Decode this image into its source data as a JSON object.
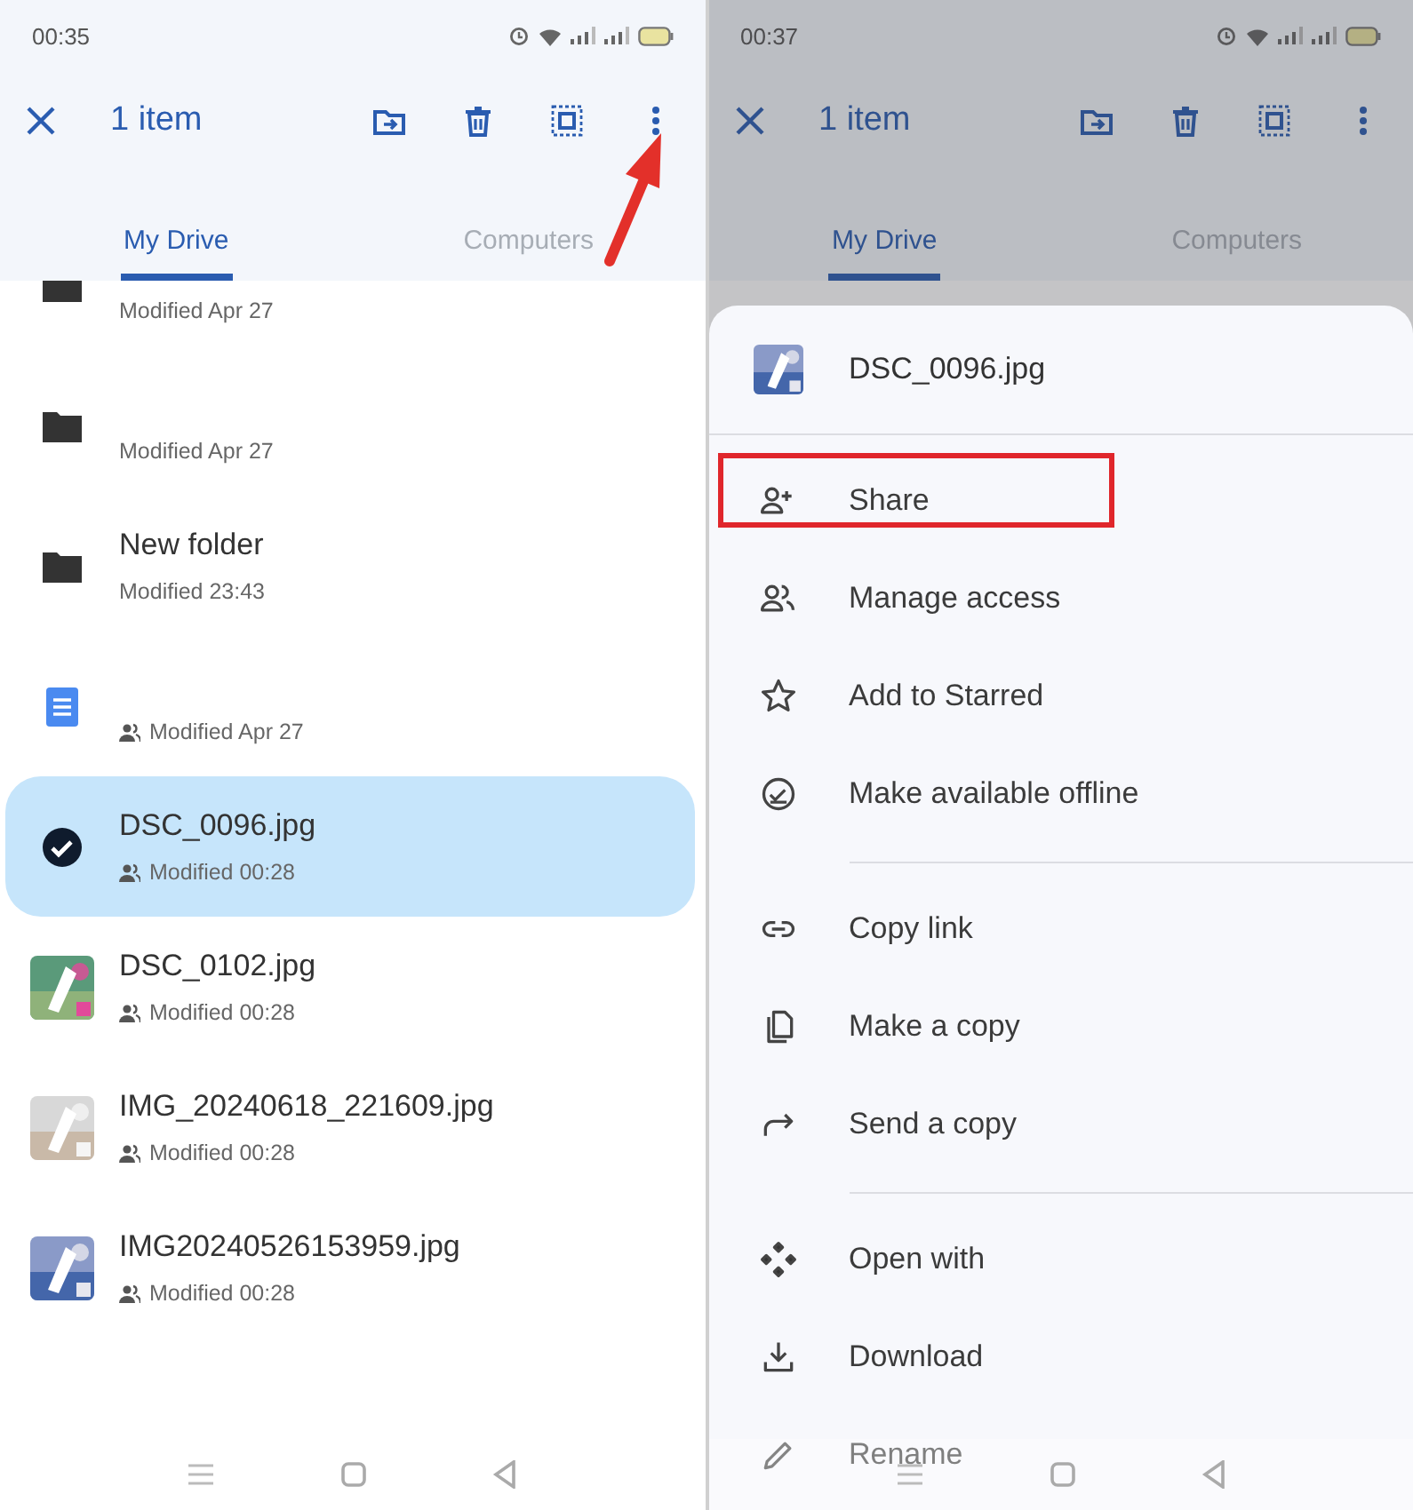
{
  "panels": [
    {
      "status_bar": {
        "time": "00:35"
      },
      "toolbar": {
        "title": "1 item",
        "pointer_arrow": true
      },
      "dimmed": false,
      "tabs": [
        {
          "label": "My Drive",
          "selected": true
        },
        {
          "label": "Computers",
          "selected": false
        }
      ],
      "files": [
        {
          "kind": "folder",
          "modified": "Modified Apr 27",
          "shared": false,
          "selected": false,
          "partial": true
        },
        {
          "kind": "folder",
          "modified": "Modified Apr 27",
          "shared": false,
          "selected": false
        },
        {
          "kind": "folder",
          "name": "New folder",
          "modified": "Modified 23:43",
          "shared": false,
          "selected": false
        },
        {
          "kind": "doc",
          "modified": "Modified Apr 27",
          "shared": true,
          "selected": false
        },
        {
          "name": "DSC_0096.jpg",
          "modified": "Modified 00:28",
          "shared": true,
          "selected": true
        },
        {
          "name": "DSC_0102.jpg",
          "modified": "Modified 00:28",
          "shared": true,
          "selected": false
        },
        {
          "name": "IMG_20240618_221609.jpg",
          "modified": "Modified 00:28",
          "shared": true,
          "selected": false
        },
        {
          "name": "IMG20240526153959.jpg",
          "modified": "Modified 00:28",
          "shared": true,
          "selected": false
        }
      ]
    },
    {
      "status_bar": {
        "time": "00:37"
      },
      "toolbar": {
        "title": "1 item",
        "pointer_arrow": false
      },
      "dimmed": true,
      "tabs": [
        {
          "label": "My Drive",
          "selected": true
        },
        {
          "label": "Computers",
          "selected": false
        }
      ],
      "sheet": {
        "file": {
          "name": "DSC_0096.jpg"
        },
        "sections": [
          {
            "items": [
              {
                "label": "Share",
                "kind": "share",
                "highlighted": true
              },
              {
                "label": "Manage access",
                "kind": "access",
                "highlighted": false
              },
              {
                "label": "Add to Starred",
                "kind": "star",
                "highlighted": false
              },
              {
                "label": "Make available offline",
                "kind": "offline",
                "highlighted": false
              }
            ]
          },
          {
            "items": [
              {
                "label": "Copy link",
                "kind": "link",
                "highlighted": false
              },
              {
                "label": "Make a copy",
                "kind": "copy",
                "highlighted": false
              },
              {
                "label": "Send a copy",
                "kind": "send",
                "highlighted": false
              }
            ]
          },
          {
            "items": [
              {
                "label": "Open with",
                "kind": "open",
                "highlighted": false
              },
              {
                "label": "Download",
                "kind": "download",
                "highlighted": false
              },
              {
                "label": "Rename",
                "kind": "rename",
                "highlighted": false
              }
            ]
          }
        ]
      }
    }
  ]
}
